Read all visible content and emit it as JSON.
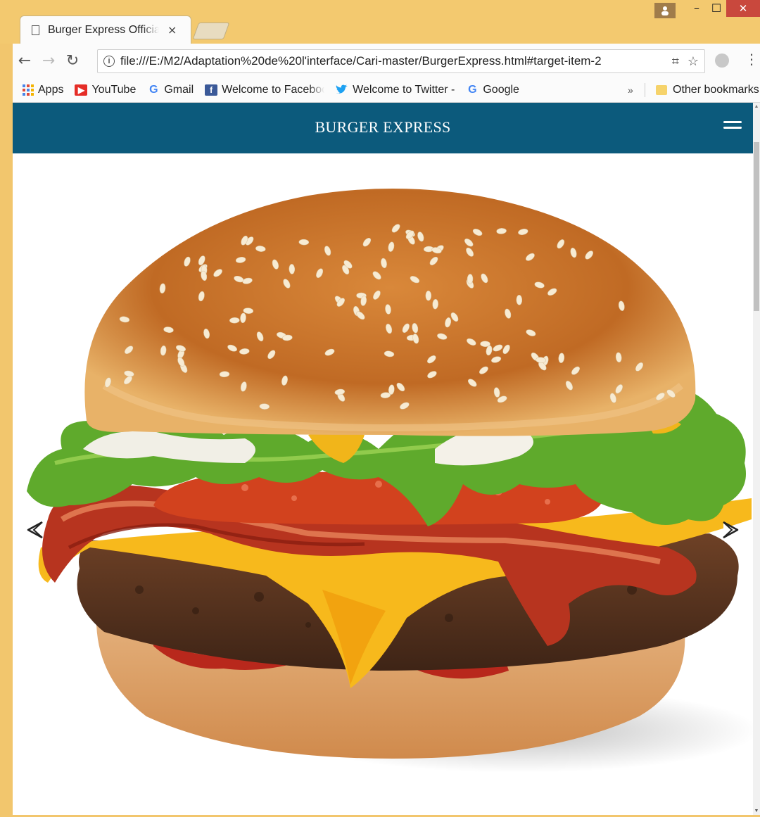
{
  "browser": {
    "tab_title": "Burger Express Official W",
    "url": "file:///E:/M2/Adaptation%20de%20l'interface/Cari-master/BurgerExpress.html#target-item-2",
    "bookmarks": [
      {
        "label": "Apps",
        "icon": "apps-icon"
      },
      {
        "label": "YouTube",
        "icon": "youtube-icon"
      },
      {
        "label": "Gmail",
        "icon": "google-icon"
      },
      {
        "label": "Welcome to Faceboo",
        "icon": "facebook-icon"
      },
      {
        "label": "Welcome to Twitter -",
        "icon": "twitter-icon"
      },
      {
        "label": "Google",
        "icon": "google-icon"
      }
    ],
    "more_bookmarks": "»",
    "other_bookmarks": "Other bookmarks"
  },
  "page": {
    "brand": "BURGER EXPRESS",
    "carousel": {
      "image": "cheeseburger-image",
      "prev_icon": "chevron-left-icon",
      "next_icon": "chevron-right-icon"
    }
  },
  "colors": {
    "navbar": "#0c5a7c",
    "window_frame": "#f2c66d"
  }
}
